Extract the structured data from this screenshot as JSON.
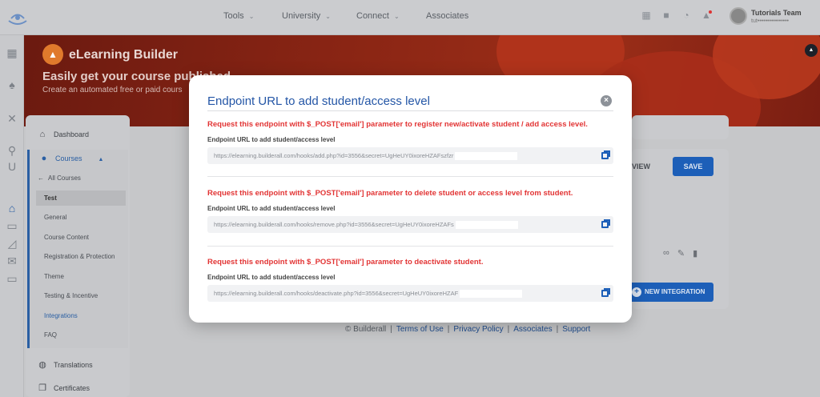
{
  "topbar": {
    "nav": [
      "Tools",
      "University",
      "Connect",
      "Associates"
    ],
    "user_name": "Tutorials Team",
    "user_email": "tut••••••••••••••••"
  },
  "banner": {
    "app_title": "eLearning Builder",
    "headline": "Easily get your course published",
    "subtitle": "Create an automated free or paid cours"
  },
  "menu": {
    "dashboard": "Dashboard",
    "courses": "Courses",
    "sub": [
      "All Courses",
      "Test",
      "General",
      "Course Content",
      "Registration & Protection",
      "Theme",
      "Testing & Incentive",
      "Integrations",
      "FAQ"
    ],
    "translations": "Translations",
    "certificates": "Certificates"
  },
  "content": {
    "view_label": "VIEW",
    "save_label": "SAVE",
    "new_integration_label": "NEW INTEGRATION"
  },
  "footer": {
    "copyright": "© Builderall",
    "links": [
      "Terms of Use",
      "Privacy Policy",
      "Associates",
      "Support"
    ]
  },
  "modal": {
    "title": "Endpoint URL to add student/access level",
    "sections": [
      {
        "request": "Request this endpoint with $_POST['email'] parameter to register new/activate student / add access level.",
        "label": "Endpoint URL to add student/access level",
        "url": "https://elearning.builderall.com/hooks/add.php?id=3556&secret=UgHeUY0ixoreHZAFszfzr"
      },
      {
        "request": "Request this endpoint with $_POST['email'] parameter to delete student or access level from student.",
        "label": "Endpoint URL to add student/access level",
        "url": "https://elearning.builderall.com/hooks/remove.php?id=3556&secret=UgHeUY0ixoreHZAFs"
      },
      {
        "request": "Request this endpoint with $_POST['email'] parameter to deactivate student.",
        "label": "Endpoint URL to add student/access level",
        "url": "https://elearning.builderall.com/hooks/deactivate.php?id=3556&secret=UgHeUY0ixoreHZAF"
      }
    ]
  },
  "colors": {
    "accent": "#2456a6",
    "danger": "#e23434",
    "primary_button": "#1d5fb8"
  }
}
